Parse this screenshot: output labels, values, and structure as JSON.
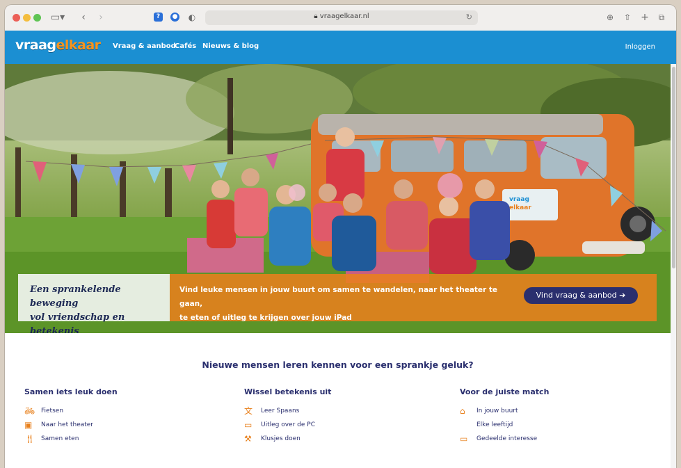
{
  "browser": {
    "url": "vraagelkaar.nl"
  },
  "nav": {
    "logo": {
      "part1": "vraag",
      "part2": "elkaar"
    },
    "links": [
      "Vraag & aanbod",
      "Cafés",
      "Nieuws & blog"
    ],
    "login": "Inloggen"
  },
  "hero": {
    "tagline_line1": "Een sprankelende beweging",
    "tagline_line2": "vol vriendschap en betekenis",
    "description_line1": "Vind leuke mensen in jouw buurt om samen te wandelen, naar het theater te gaan,",
    "description_line2": "te eten of uitleg te krijgen over jouw iPad",
    "cta_label": "Vind vraag & aanbod ➔",
    "van_sign_line1": "vraag",
    "van_sign_line2": "elkaar"
  },
  "main": {
    "headline": "Nieuwe mensen leren kennen voor een sprankje geluk?",
    "columns": [
      {
        "title": "Samen iets leuk doen",
        "items": [
          {
            "icon": "bicycle-icon",
            "label": "Fietsen"
          },
          {
            "icon": "theater-icon",
            "label": "Naar het theater"
          },
          {
            "icon": "cutlery-icon",
            "label": "Samen eten"
          }
        ]
      },
      {
        "title": "Wissel betekenis uit",
        "items": [
          {
            "icon": "language-icon",
            "label": "Leer Spaans"
          },
          {
            "icon": "computer-help-icon",
            "label": "Uitleg over de PC"
          },
          {
            "icon": "tools-icon",
            "label": "Klusjes doen"
          }
        ]
      },
      {
        "title": "Voor de juiste match",
        "items": [
          {
            "icon": "neighborhood-icon",
            "label": "In jouw buurt"
          },
          {
            "icon": "",
            "label": "Elke leeftijd"
          },
          {
            "icon": "shared-interest-icon",
            "label": "Gedeelde interesse"
          }
        ]
      }
    ]
  },
  "colors": {
    "nav_bg": "#1b8fd2",
    "accent_orange": "#e8801c",
    "navy": "#2a2f6e"
  }
}
